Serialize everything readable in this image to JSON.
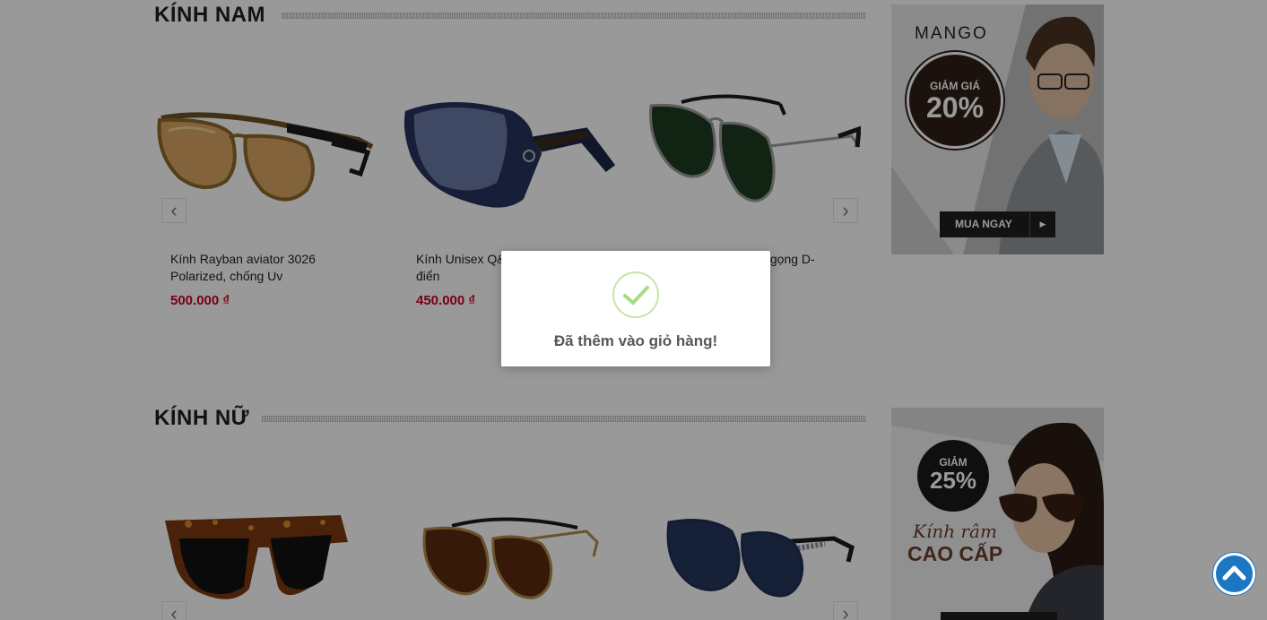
{
  "sections": [
    {
      "title": "KÍNH NAM",
      "products": [
        {
          "name": "Kính Rayban aviator 3026 Polarized, chống Uv",
          "price": "500.000 ₫"
        },
        {
          "name": "Kính Unisex Q&J",
          "name_line2": "điển",
          "price": "450.000 ₫"
        },
        {
          "name": "...J&J gọng D-"
        }
      ],
      "banner": {
        "brand": "MANGO",
        "discount_label": "GIẢM GIÁ",
        "discount_value": "20%",
        "cta": "MUA NGAY"
      }
    },
    {
      "title": "KÍNH NỮ",
      "products": [
        {},
        {},
        {}
      ],
      "banner": {
        "discount_label": "GIẢM",
        "discount_value": "25%",
        "line1": "Kính râm",
        "line2": "CAO CẤP"
      }
    }
  ],
  "popup": {
    "message": "Đã thêm vào giỏ hàng!"
  },
  "colors": {
    "price": "#c8001f",
    "overlay": "rgba(0,0,0,0.40)",
    "check": "#a5dc86",
    "back_to_top": "#1c77c3"
  },
  "icons": {
    "prev": "chevron-left-icon",
    "next": "chevron-right-icon",
    "success": "check-icon",
    "back_to_top": "chevron-up-icon"
  }
}
